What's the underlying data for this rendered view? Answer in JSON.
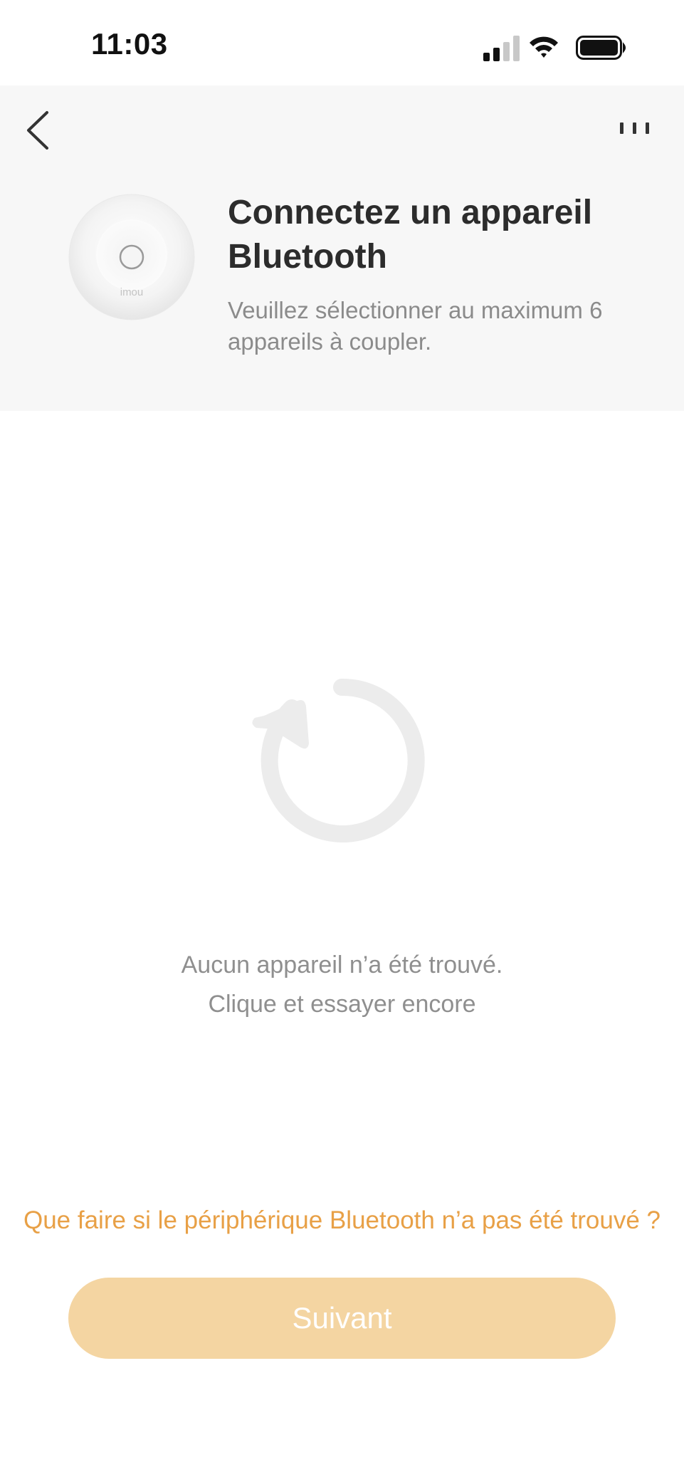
{
  "status_bar": {
    "time": "11:03",
    "signal_icon": "cellular-signal-icon",
    "wifi_icon": "wifi-icon",
    "battery_icon": "battery-icon"
  },
  "header": {
    "back_icon": "chevron-left-icon",
    "more_icon": "more-dots-icon",
    "title": "Connectez un appareil Bluetooth",
    "subtitle": "Veuillez sélectionner au maximum 6 appareils à coupler.",
    "device_brand": "imou"
  },
  "main": {
    "refresh_icon": "refresh-icon",
    "empty_line1": "Aucun appareil n’a été trouvé.",
    "empty_line2": "Clique et essayer encore"
  },
  "footer": {
    "help_link": "Que faire si le périphérique Bluetooth n’a pas été trouvé ?",
    "next_label": "Suivant"
  },
  "colors": {
    "accent": "#e8a046",
    "button_disabled": "#f4d5a2",
    "header_bg": "#f7f7f7"
  }
}
